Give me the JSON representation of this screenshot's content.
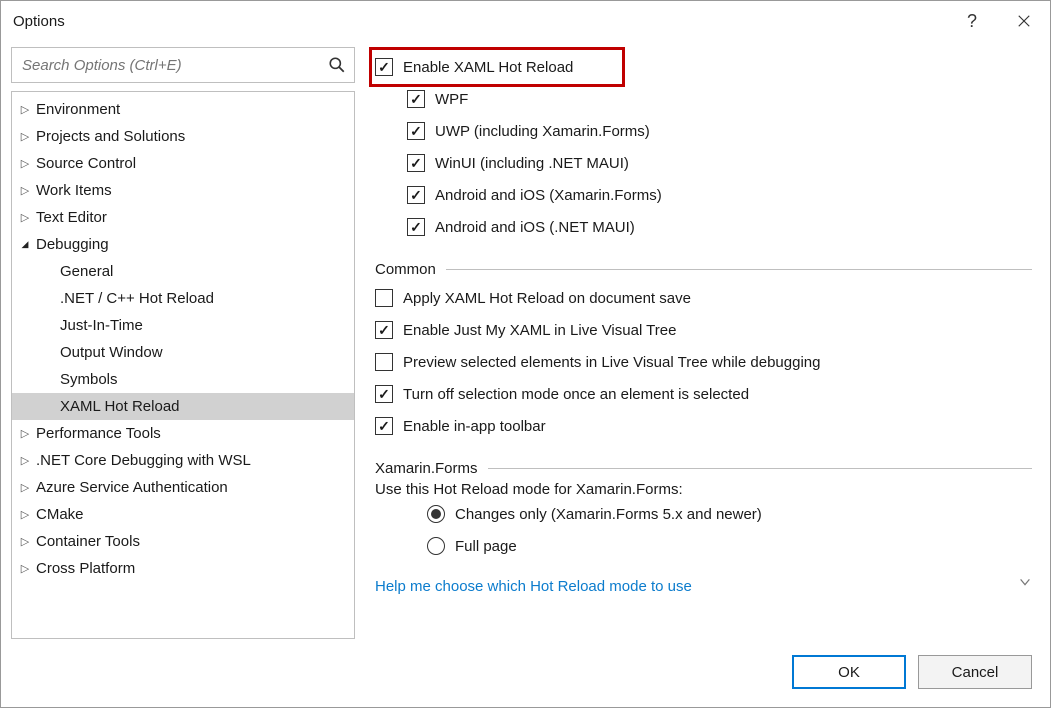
{
  "window": {
    "title": "Options"
  },
  "search": {
    "placeholder": "Search Options (Ctrl+E)"
  },
  "tree": [
    {
      "label": "Environment",
      "level": 0,
      "expand": "closed"
    },
    {
      "label": "Projects and Solutions",
      "level": 0,
      "expand": "closed"
    },
    {
      "label": "Source Control",
      "level": 0,
      "expand": "closed"
    },
    {
      "label": "Work Items",
      "level": 0,
      "expand": "closed"
    },
    {
      "label": "Text Editor",
      "level": 0,
      "expand": "closed"
    },
    {
      "label": "Debugging",
      "level": 0,
      "expand": "open"
    },
    {
      "label": "General",
      "level": 1,
      "expand": "none"
    },
    {
      "label": ".NET / C++ Hot Reload",
      "level": 1,
      "expand": "none"
    },
    {
      "label": "Just-In-Time",
      "level": 1,
      "expand": "none"
    },
    {
      "label": "Output Window",
      "level": 1,
      "expand": "none"
    },
    {
      "label": "Symbols",
      "level": 1,
      "expand": "none"
    },
    {
      "label": "XAML Hot Reload",
      "level": 1,
      "expand": "none",
      "selected": true
    },
    {
      "label": "Performance Tools",
      "level": 0,
      "expand": "closed"
    },
    {
      "label": ".NET Core Debugging with WSL",
      "level": 0,
      "expand": "closed"
    },
    {
      "label": "Azure Service Authentication",
      "level": 0,
      "expand": "closed"
    },
    {
      "label": "CMake",
      "level": 0,
      "expand": "closed"
    },
    {
      "label": "Container Tools",
      "level": 0,
      "expand": "closed"
    },
    {
      "label": "Cross Platform",
      "level": 0,
      "expand": "closed"
    }
  ],
  "main": {
    "enable": {
      "label": "Enable XAML Hot Reload",
      "checked": true
    },
    "platforms": [
      {
        "label": "WPF",
        "checked": true
      },
      {
        "label": "UWP (including Xamarin.Forms)",
        "checked": true
      },
      {
        "label": "WinUI (including .NET MAUI)",
        "checked": true
      },
      {
        "label": "Android and iOS (Xamarin.Forms)",
        "checked": true
      },
      {
        "label": "Android and iOS (.NET MAUI)",
        "checked": true
      }
    ],
    "common_header": "Common",
    "common": [
      {
        "label": "Apply XAML Hot Reload on document save",
        "checked": false
      },
      {
        "label": "Enable Just My XAML in Live Visual Tree",
        "checked": true
      },
      {
        "label": "Preview selected elements in Live Visual Tree while debugging",
        "checked": false
      },
      {
        "label": "Turn off selection mode once an element is selected",
        "checked": true
      },
      {
        "label": "Enable in-app toolbar",
        "checked": true
      }
    ],
    "xf_header": "Xamarin.Forms",
    "xf_prompt": "Use this Hot Reload mode for Xamarin.Forms:",
    "xf_options": [
      {
        "label": "Changes only (Xamarin.Forms 5.x and newer)",
        "checked": true
      },
      {
        "label": "Full page",
        "checked": false
      }
    ],
    "help_link": "Help me choose which Hot Reload mode to use"
  },
  "footer": {
    "ok": "OK",
    "cancel": "Cancel"
  }
}
